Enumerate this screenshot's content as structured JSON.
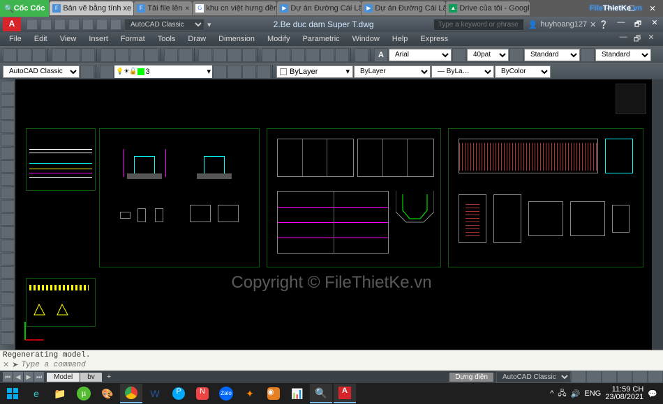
{
  "browser": {
    "logo": "Cốc Cốc",
    "tabs": [
      {
        "icon": "File",
        "label": "Bản vẽ bằng tính xe đú"
      },
      {
        "icon": "File",
        "label": "Tải file lên"
      },
      {
        "icon": "G",
        "label": "khu cn việt hưng đền c"
      },
      {
        "icon": "▶",
        "label": "Dự án Đường Cái Lân -"
      },
      {
        "icon": "▶",
        "label": "Dự án Đường Cái Lân -"
      },
      {
        "icon": "▲",
        "label": "Drive của tôi - Google D"
      }
    ],
    "sys": {
      "min": "—",
      "max": "☐",
      "close": "✕"
    }
  },
  "acad": {
    "logo": "A",
    "workspace": "AutoCAD Classic",
    "title": "2.Be duc dam Super T.dwg",
    "search_placeholder": "Type a keyword or phrase",
    "user": "huyhoang127",
    "menus": [
      "File",
      "Edit",
      "View",
      "Insert",
      "Format",
      "Tools",
      "Draw",
      "Dimension",
      "Modify",
      "Parametric",
      "Window",
      "Help",
      "Express"
    ],
    "layer_name": "3",
    "font": "Arial",
    "pat": "40pat",
    "std1": "Standard",
    "std2": "Standard",
    "prop_ws": "AutoCAD Classic",
    "bylayer1": "ByLayer",
    "bylayer2": "ByLayer",
    "bycolor": "ByColor"
  },
  "cmd": {
    "history": "Regenerating model.",
    "prompt_placeholder": "Type a command"
  },
  "layout": {
    "tabs": [
      "Model",
      "bv"
    ]
  },
  "status": {
    "label": "Dựng điện",
    "ws": "AutoCAD Classic"
  },
  "taskbar": {
    "tray": {
      "lang": "ENG",
      "time": "11:59 CH",
      "date": "23/08/2021"
    }
  },
  "watermark": {
    "brand_a": "File",
    "brand_b": "ThietKe",
    "brand_c": ".vn",
    "center": "Copyright © FileThietKe.vn"
  }
}
